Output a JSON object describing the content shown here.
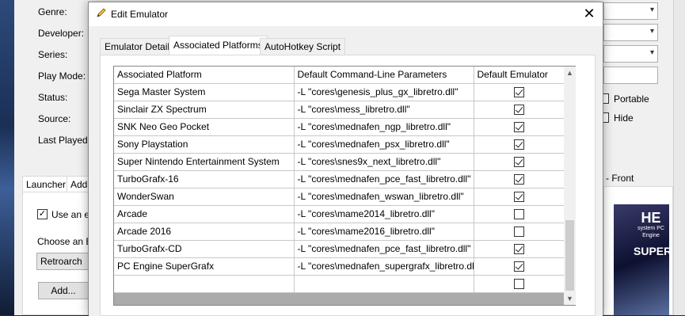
{
  "background": {
    "labels": [
      "Genre:",
      "Developer:",
      "Series:",
      "Play Mode:",
      "Status:",
      "Source:",
      "Last Played:"
    ],
    "checkboxes": {
      "portable": "Portable",
      "hide": "Hide"
    },
    "tabs": {
      "launcher": "Launcher",
      "additional": "Addi"
    },
    "use_emulator_label": "Use an er",
    "choose_emulator_label": "Choose an Er",
    "emulator_combo_value": "Retroarch",
    "add_button_label": "Add...",
    "front_tab_label": "- Front",
    "cover_logo_top": "HE",
    "cover_logo_sub": "system PC Engine",
    "cover_logo_name": "SUPER"
  },
  "dialog": {
    "title": "Edit Emulator",
    "close_symbol": "✕",
    "tabs": [
      {
        "label": "Emulator Details",
        "active": false
      },
      {
        "label": "Associated Platforms",
        "active": true
      },
      {
        "label": "AutoHotkey Script",
        "active": false
      }
    ],
    "grid": {
      "columns": [
        "Associated Platform",
        "Default Command-Line Parameters",
        "Default Emulator"
      ],
      "rows": [
        {
          "platform": "Sega Master System",
          "params": "-L \"cores\\genesis_plus_gx_libretro.dll\"",
          "default": true
        },
        {
          "platform": "Sinclair ZX Spectrum",
          "params": "-L \"cores\\mess_libretro.dll\"",
          "default": true
        },
        {
          "platform": "SNK Neo Geo Pocket",
          "params": "-L \"cores\\mednafen_ngp_libretro.dll\"",
          "default": true
        },
        {
          "platform": "Sony Playstation",
          "params": "-L \"cores\\mednafen_psx_libretro.dll\"",
          "default": true
        },
        {
          "platform": "Super Nintendo Entertainment System",
          "params": "-L \"cores\\snes9x_next_libretro.dll\"",
          "default": true
        },
        {
          "platform": "TurboGrafx-16",
          "params": "-L \"cores\\mednafen_pce_fast_libretro.dll\"",
          "default": true
        },
        {
          "platform": "WonderSwan",
          "params": "-L \"cores\\mednafen_wswan_libretro.dll\"",
          "default": true
        },
        {
          "platform": "Arcade",
          "params": "-L \"cores\\mame2014_libretro.dll\"",
          "default": false
        },
        {
          "platform": "Arcade 2016",
          "params": "-L \"cores\\mame2016_libretro.dll\"",
          "default": false
        },
        {
          "platform": "TurboGrafx-CD",
          "params": "-L \"cores\\mednafen_pce_fast_libretro.dll\"",
          "default": true
        },
        {
          "platform": "PC Engine SuperGrafx",
          "params": "-L \"cores\\mednafen_supergrafx_libretro.dll\"",
          "default": true
        },
        {
          "platform": "",
          "params": "",
          "default": false
        }
      ]
    }
  },
  "colors": {
    "grid_empty": "#ababab",
    "dialog_bg": "#f0f0f0"
  }
}
